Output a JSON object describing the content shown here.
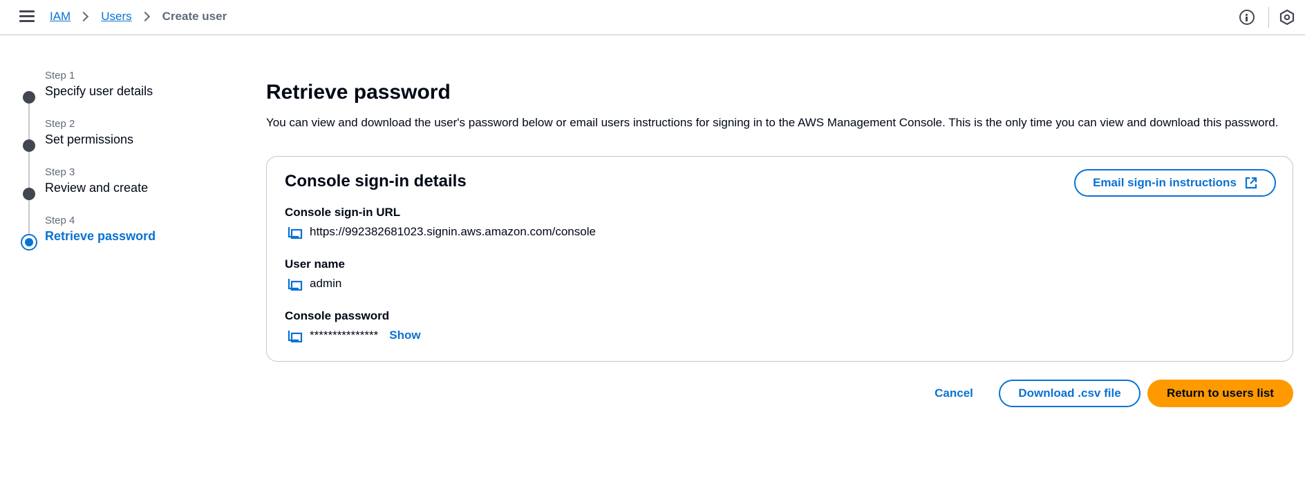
{
  "header": {
    "breadcrumbs": [
      {
        "label": "IAM",
        "link": true
      },
      {
        "label": "Users",
        "link": true
      },
      {
        "label": "Create user",
        "link": false
      }
    ]
  },
  "steps": [
    {
      "label": "Step 1",
      "title": "Specify user details"
    },
    {
      "label": "Step 2",
      "title": "Set permissions"
    },
    {
      "label": "Step 3",
      "title": "Review and create"
    },
    {
      "label": "Step 4",
      "title": "Retrieve password",
      "active": true
    }
  ],
  "main": {
    "title": "Retrieve password",
    "description": "You can view and download the user's password below or email users instructions for signing in to the AWS Management Console. This is the only time you can view and download this password."
  },
  "card": {
    "title": "Console sign-in details",
    "email_button": "Email sign-in instructions",
    "fields": [
      {
        "label": "Console sign-in URL",
        "value": "https://992382681023.signin.aws.amazon.com/console"
      },
      {
        "label": "User name",
        "value": "admin"
      },
      {
        "label": "Console password",
        "value": "***************",
        "show_label": "Show"
      }
    ]
  },
  "actions": {
    "cancel": "Cancel",
    "download": "Download .csv file",
    "return": "Return to users list"
  },
  "colors": {
    "accent": "#0972d3",
    "primary_button": "#ff9900",
    "text": "#000716"
  }
}
